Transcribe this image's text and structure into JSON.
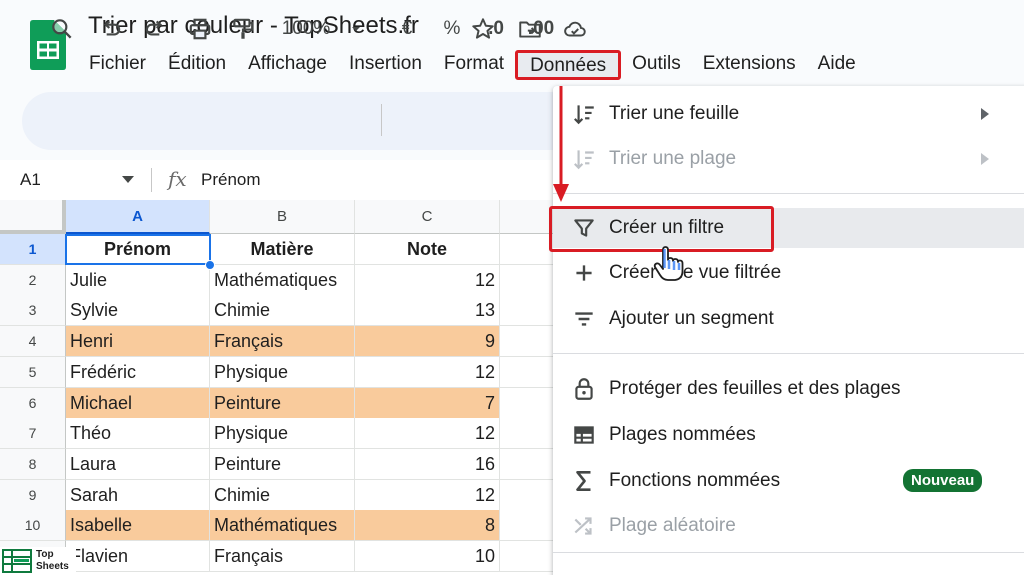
{
  "document": {
    "title": "Trier par couleur - TopSheets.fr"
  },
  "menubar": {
    "items": [
      "Fichier",
      "Édition",
      "Affichage",
      "Insertion",
      "Format",
      "Données",
      "Outils",
      "Extensions",
      "Aide"
    ],
    "active": "Données"
  },
  "toolbar": {
    "zoom": "100%",
    "currency": "€",
    "percent": "%",
    "decrease_decimal": ".0",
    "increase_decimal": ".00"
  },
  "formula_bar": {
    "cell_ref": "A1",
    "fx": "fx",
    "value": "Prénom"
  },
  "grid": {
    "columns": [
      "A",
      "B",
      "C"
    ],
    "selected_column": "A",
    "rows": [
      {
        "num": "1",
        "cells": [
          "Prénom",
          "Matière",
          "Note"
        ],
        "header": true
      },
      {
        "num": "2",
        "cells": [
          "Julie",
          "Mathématiques",
          "12"
        ],
        "highlight": false
      },
      {
        "num": "3",
        "cells": [
          "Sylvie",
          "Chimie",
          "13"
        ],
        "highlight": false
      },
      {
        "num": "4",
        "cells": [
          "Henri",
          "Français",
          "9"
        ],
        "highlight": true
      },
      {
        "num": "5",
        "cells": [
          "Frédéric",
          "Physique",
          "12"
        ],
        "highlight": false
      },
      {
        "num": "6",
        "cells": [
          "Michael",
          "Peinture",
          "7"
        ],
        "highlight": true
      },
      {
        "num": "7",
        "cells": [
          "Théo",
          "Physique",
          "12"
        ],
        "highlight": false
      },
      {
        "num": "8",
        "cells": [
          "Laura",
          "Peinture",
          "16"
        ],
        "highlight": false
      },
      {
        "num": "9",
        "cells": [
          "Sarah",
          "Chimie",
          "12"
        ],
        "highlight": false
      },
      {
        "num": "10",
        "cells": [
          "Isabelle",
          "Mathématiques",
          "8"
        ],
        "highlight": true
      },
      {
        "num": "",
        "cells": [
          "Flavien",
          "Français",
          "10"
        ],
        "highlight": false
      }
    ],
    "highlight_color": "#f9cb9c"
  },
  "data_menu": {
    "items": [
      {
        "label": "Trier une feuille",
        "icon": "sort-icon",
        "submenu": true,
        "disabled": false
      },
      {
        "label": "Trier une plage",
        "icon": "sort-icon",
        "submenu": true,
        "disabled": true
      },
      {
        "label": "Créer un filtre",
        "icon": "filter-icon",
        "submenu": false,
        "disabled": false,
        "hover": true
      },
      {
        "label": "Créer une vue filtrée",
        "icon": "plus-icon",
        "submenu": false,
        "disabled": false
      },
      {
        "label": "Ajouter un segment",
        "icon": "slicer-icon",
        "submenu": false,
        "disabled": false
      },
      {
        "label": "Protéger des feuilles et des plages",
        "icon": "lock-icon",
        "submenu": false,
        "disabled": false
      },
      {
        "label": "Plages nommées",
        "icon": "named-ranges-icon",
        "submenu": false,
        "disabled": false
      },
      {
        "label": "Fonctions nommées",
        "icon": "sigma-icon",
        "submenu": false,
        "disabled": false,
        "badge": "Nouveau"
      },
      {
        "label": "Plage aléatoire",
        "icon": "shuffle-icon",
        "submenu": false,
        "disabled": true
      }
    ]
  },
  "watermark": {
    "line1": "Top",
    "line2": "Sheets"
  },
  "colors": {
    "accent": "#0b57d0",
    "annotation_red": "#d91c24",
    "badge_green": "#137333"
  }
}
